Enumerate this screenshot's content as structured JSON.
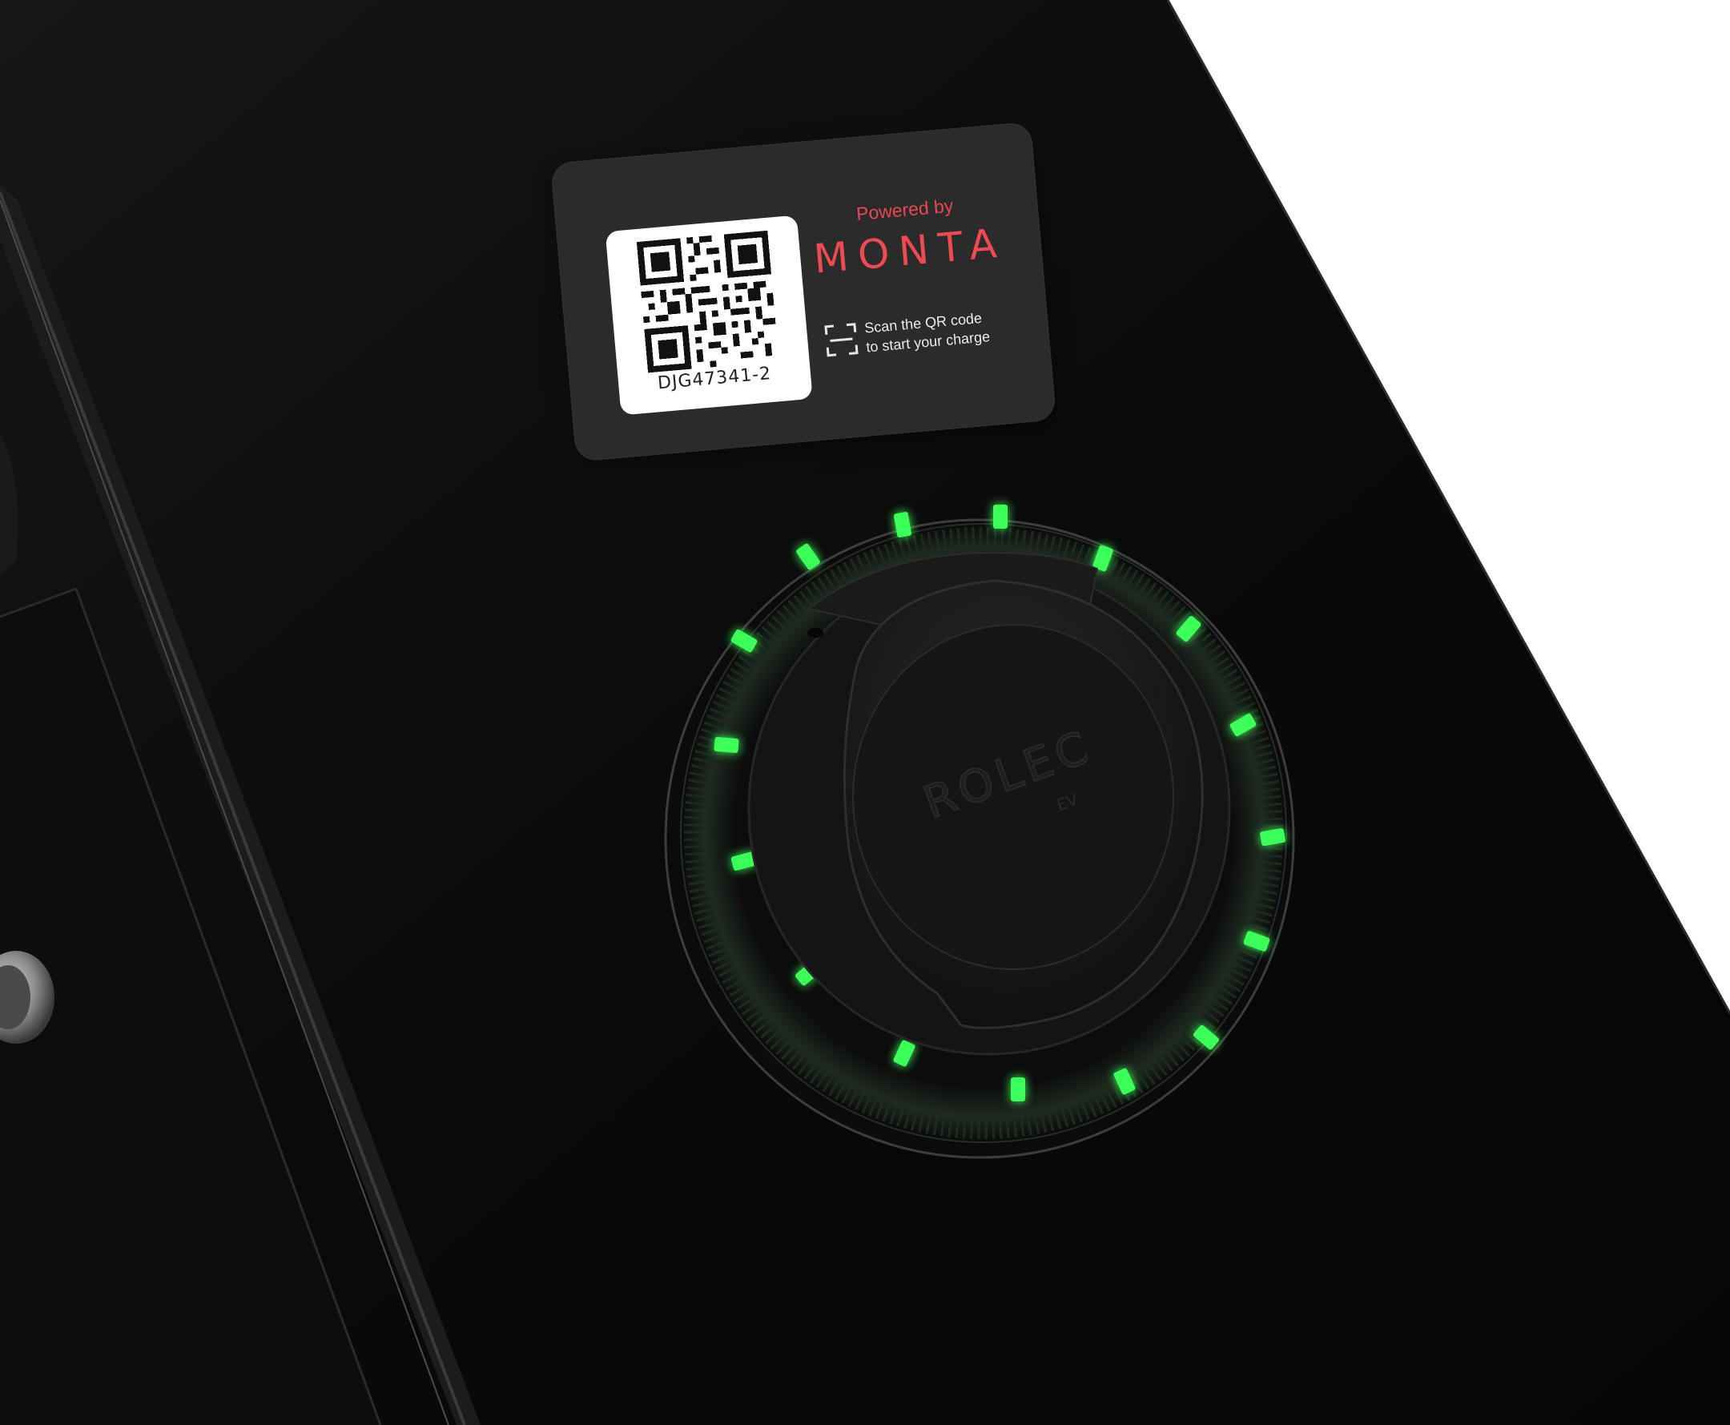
{
  "label": {
    "qr_id": "DJG47341-2",
    "powered_by": "Powered by",
    "brand": "MONTA",
    "scan_line_1": "Scan the QR code",
    "scan_line_2": "to start your charge",
    "brand_color": "#ee4a52"
  },
  "socket": {
    "cover_brand": "ROLEC",
    "cover_sub": "EV",
    "ring_color": "#3cff5a",
    "icons": [
      "qr-code-icon",
      "scan-frame-icon"
    ]
  },
  "colors": {
    "body": "#0a0a0a",
    "background": "#ffffff",
    "led": "#3cff5a"
  }
}
